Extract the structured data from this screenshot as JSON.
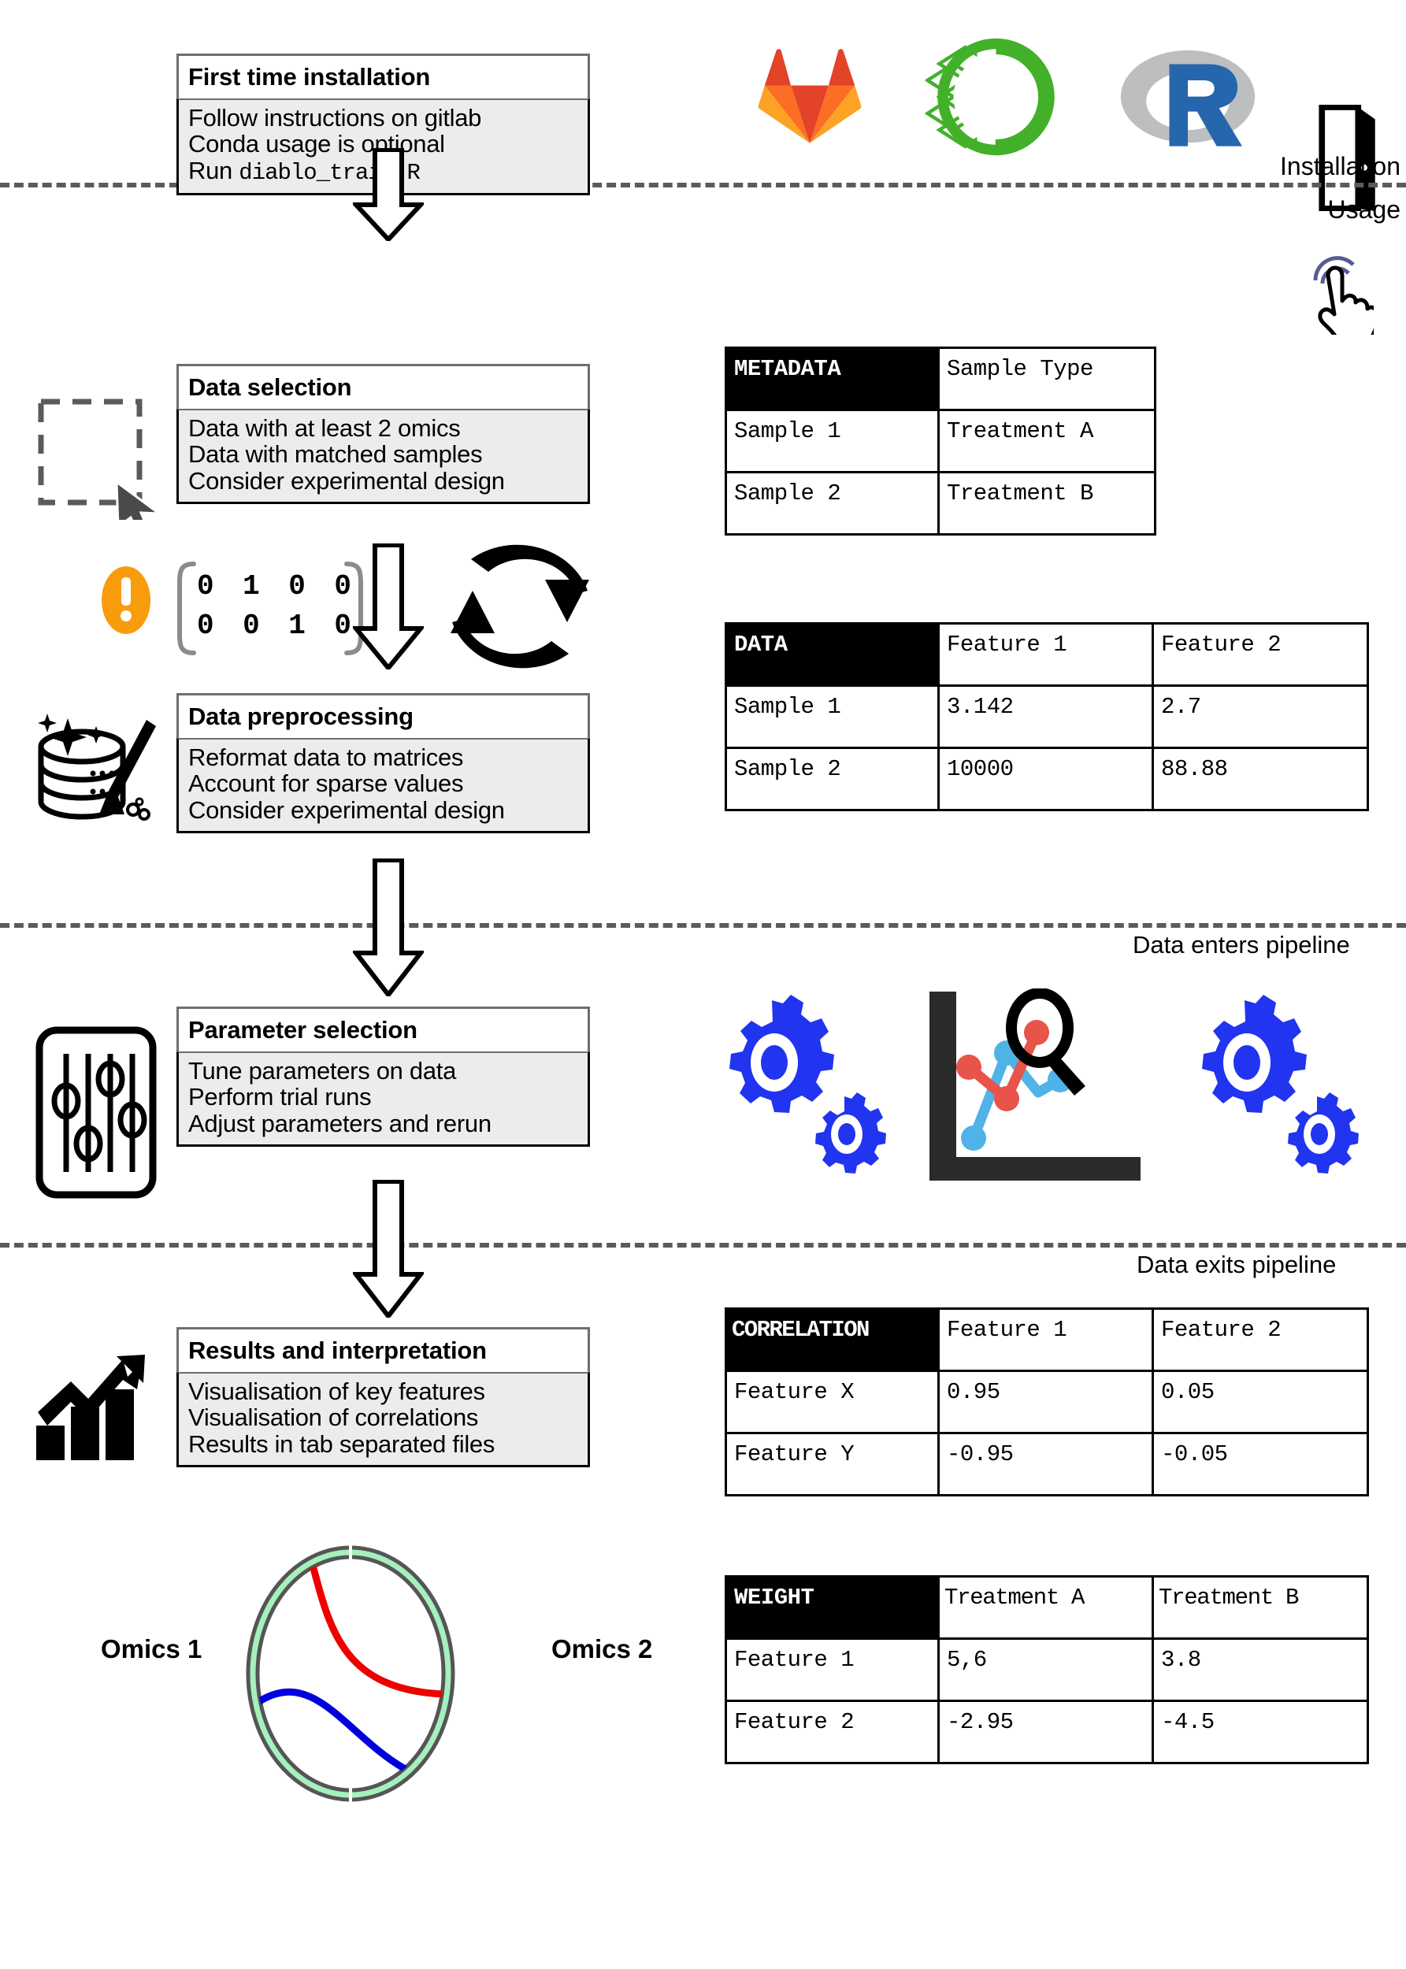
{
  "stages": [
    {
      "id": "first-time-installation",
      "title": "First time installation",
      "lines": [
        "Follow instructions on gitlab",
        "Conda usage is optional"
      ],
      "run_prefix": "Run",
      "run_script": "diablo_train.R"
    },
    {
      "id": "data-selection",
      "title": "Data selection",
      "lines": [
        "Data with at least 2 omics",
        "Data with matched samples",
        "Consider experimental design"
      ]
    },
    {
      "id": "data-preprocessing",
      "title": "Data preprocessing",
      "lines": [
        "Reformat data to matrices",
        "Account for sparse values",
        "Consider experimental design"
      ]
    },
    {
      "id": "parameter-selection",
      "title": "Parameter selection",
      "lines": [
        "Tune parameters on data",
        "Perform trial runs",
        "Adjust parameters and rerun"
      ]
    },
    {
      "id": "results-and-interpretation",
      "title": "Results and interpretation",
      "lines": [
        "Visualisation of key features",
        "Visualisation of correlations",
        "Results in tab separated files"
      ]
    }
  ],
  "separators": {
    "installation": "Installation",
    "usage": "Usage",
    "enters": "Data enters pipeline",
    "exits": "Data exits pipeline"
  },
  "design_matrix": {
    "rows": [
      [
        "0",
        "1",
        "0",
        "0"
      ],
      [
        "0",
        "0",
        "1",
        "0"
      ]
    ]
  },
  "tables": {
    "metadata": {
      "corner": "METADATA",
      "columns": [
        "Sample Type"
      ],
      "rows": [
        {
          "label": "Sample 1",
          "cells": [
            "Treatment A"
          ]
        },
        {
          "label": "Sample 2",
          "cells": [
            "Treatment B"
          ]
        }
      ]
    },
    "data": {
      "corner": "DATA",
      "columns": [
        "Feature 1",
        "Feature 2"
      ],
      "rows": [
        {
          "label": "Sample 1",
          "cells": [
            "3.142",
            "2.7"
          ]
        },
        {
          "label": "Sample 2",
          "cells": [
            "10000",
            "88.88"
          ]
        }
      ]
    },
    "correlation": {
      "corner": "CORRELATION",
      "columns": [
        "Feature 1",
        "Feature 2"
      ],
      "rows": [
        {
          "label": "Feature X",
          "cells": [
            "0.95",
            "0.05"
          ]
        },
        {
          "label": "Feature Y",
          "cells": [
            "-0.95",
            "-0.05"
          ]
        }
      ]
    },
    "weight": {
      "corner": "WEIGHT",
      "columns": [
        "Treatment A",
        "Treatment B"
      ],
      "rows": [
        {
          "label": "Feature 1",
          "cells": [
            "5,6",
            "3.8"
          ]
        },
        {
          "label": "Feature 2",
          "cells": [
            "-2.95",
            "-4.5"
          ]
        }
      ]
    }
  },
  "circos": {
    "left_label": "Omics 1",
    "right_label": "Omics 2",
    "ring_color": "#a5f0bd",
    "ring_stroke": "#555555",
    "link_colors": [
      "#ee0000",
      "#0000dd"
    ]
  },
  "colors": {
    "gitlab_orange": "#fc6d26",
    "gitlab_red": "#e24329",
    "gitlab_amber": "#fca326",
    "conda_green": "#43b02a",
    "r_blue": "#2566ac",
    "r_grey": "#bbbbbb",
    "warning_orange": "#f89c0e",
    "gear_blue": "#2134f0",
    "chart_red": "#e8534a",
    "chart_blue": "#4fb3e8",
    "cursor_purple": "#5a5a96",
    "box_fill": "#ececec",
    "box_border": "#6e6e6e"
  }
}
